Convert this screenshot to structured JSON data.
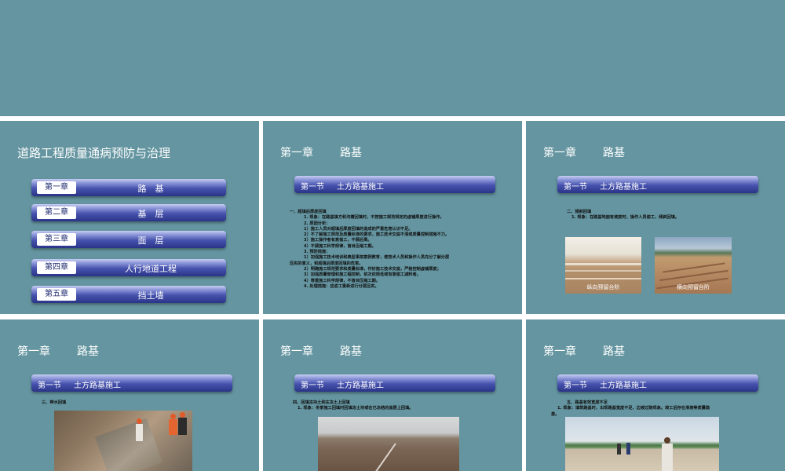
{
  "chapter_heading": {
    "label": "第一章",
    "name": "路基"
  },
  "slides": {
    "s1": {
      "title": "道路工程质量通病预防与治理",
      "toc": [
        {
          "chapter": "第一章",
          "name": "路　基"
        },
        {
          "chapter": "第二章",
          "name": "基　层"
        },
        {
          "chapter": "第三章",
          "name": "面　层"
        },
        {
          "chapter": "第四章",
          "name": "人行地道工程"
        },
        {
          "chapter": "第五章",
          "name": "挡土墙"
        }
      ]
    },
    "section_bar": {
      "section": "第一节",
      "title": "土方路基施工"
    },
    "s2": {
      "lines": [
        "一、超填后厚度回填",
        "1. 现象：在路基填方和沟槽回填时，不按施工规范规定的虚铺厚度进行操作。",
        "2. 原因分析：",
        "1）施工人员对超填后厚度回填的造成的严重危害认识不足。",
        "2）不了解施工规范及质量标准的要求，施工技术交底不清或质量控制措施不力。",
        "3）施工操作者有意偷工，不顾后果。",
        "4）不顾施工科学规律，盲目压缩工期。",
        "3. 预防措施：",
        "1）加强施工技术培训和典型事故案例教育，使技术人员和操作人员充分了解分层",
        "压实的意义，和超填后厚度回填的危害。",
        "2）明确施工规范要求和质量标准，作好施工技术交底，严格控制虚铺厚度；",
        "3）加强质量管理和施工程控制，依次依规低或有意偷工减料者。",
        "4）尊重施工科学规律，不盲目压缩工期。",
        "4. 处理措施：应返工重新进行分层压实。"
      ]
    },
    "s3": {
      "lines": [
        "二、倾斜回填",
        "1. 现象：在路基地面有坡度时，操作人员偷工，倾斜回填。"
      ],
      "captions": [
        "纵向预留台阶",
        "横向预留台阶"
      ]
    },
    "s4": {
      "lines": [
        "三、带水回填"
      ]
    },
    "s5": {
      "lines": [
        "四、回填冻块土和在冻土上回填",
        "1. 现象：冬季施工回填时回填冻土块或在已冻结的底层上回填。"
      ]
    },
    "s6": {
      "lines": [
        "五、路基有效宽度不足",
        "1. 现象：填筑路基时，出现路基宽度不足、边坡过陡现象。竣工后存在滑坡等质量隐",
        "患。"
      ]
    }
  }
}
